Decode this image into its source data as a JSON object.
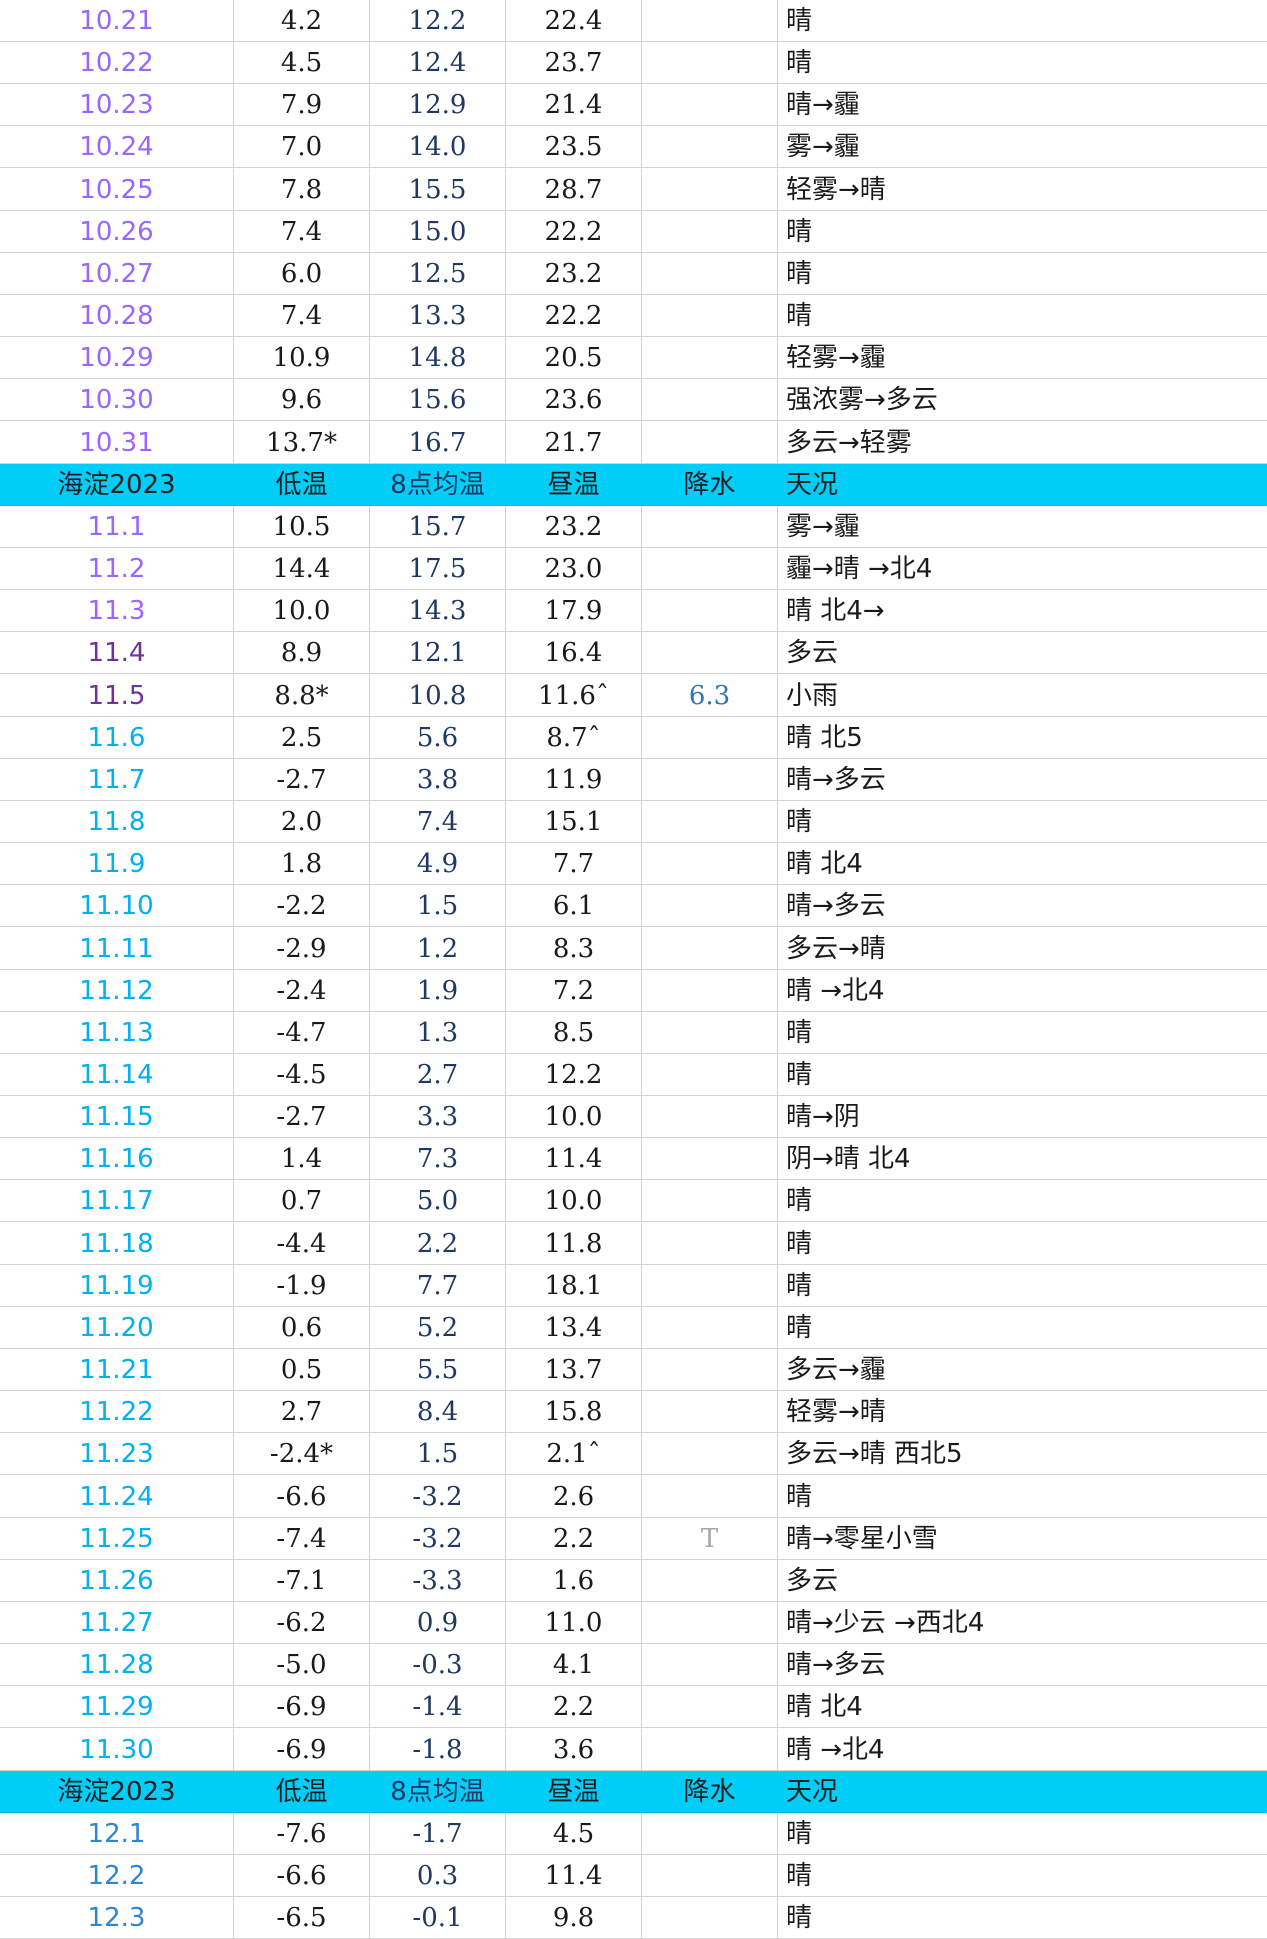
{
  "colors": {
    "header_bg": "#00cdf8",
    "date_purple": "#9966ff",
    "date_dark_purple": "#7030a0",
    "date_cyan": "#00b0f0",
    "date_blue": "#2e86d1",
    "rain_blue": "#2e75b6"
  },
  "rows": [
    {
      "type": "data",
      "date": "10.21",
      "low": "4.2",
      "avg": "12.2",
      "day": "22.4",
      "rain": "",
      "cond": "晴",
      "date_color": "#9966ff"
    },
    {
      "type": "data",
      "date": "10.22",
      "low": "4.5",
      "avg": "12.4",
      "day": "23.7",
      "rain": "",
      "cond": "晴",
      "date_color": "#9966ff"
    },
    {
      "type": "data",
      "date": "10.23",
      "low": "7.9",
      "avg": "12.9",
      "day": "21.4",
      "rain": "",
      "cond": "晴→霾",
      "date_color": "#9966ff"
    },
    {
      "type": "data",
      "date": "10.24",
      "low": "7.0",
      "avg": "14.0",
      "day": "23.5",
      "rain": "",
      "cond": "雾→霾",
      "date_color": "#9966ff"
    },
    {
      "type": "data",
      "date": "10.25",
      "low": "7.8",
      "avg": "15.5",
      "day": "28.7",
      "rain": "",
      "cond": "轻雾→晴",
      "date_color": "#9966ff"
    },
    {
      "type": "data",
      "date": "10.26",
      "low": "7.4",
      "avg": "15.0",
      "day": "22.2",
      "rain": "",
      "cond": "晴",
      "date_color": "#9966ff"
    },
    {
      "type": "data",
      "date": "10.27",
      "low": "6.0",
      "avg": "12.5",
      "day": "23.2",
      "rain": "",
      "cond": "晴",
      "date_color": "#9966ff"
    },
    {
      "type": "data",
      "date": "10.28",
      "low": "7.4",
      "avg": "13.3",
      "day": "22.2",
      "rain": "",
      "cond": "晴",
      "date_color": "#9966ff"
    },
    {
      "type": "data",
      "date": "10.29",
      "low": "10.9",
      "avg": "14.8",
      "day": "20.5",
      "rain": "",
      "cond": "轻雾→霾",
      "date_color": "#9966ff"
    },
    {
      "type": "data",
      "date": "10.30",
      "low": "9.6",
      "avg": "15.6",
      "day": "23.6",
      "rain": "",
      "cond": "强浓雾→多云",
      "date_color": "#9966ff"
    },
    {
      "type": "data",
      "date": "10.31",
      "low": "13.7*",
      "avg": "16.7",
      "day": "21.7",
      "rain": "",
      "cond": "多云→轻雾",
      "date_color": "#9966ff"
    },
    {
      "type": "header",
      "date": "海淀2023",
      "low": "低温",
      "avg": "8点均温",
      "day": "昼温",
      "rain": "降水",
      "cond": "天况"
    },
    {
      "type": "data",
      "date": "11.1",
      "low": "10.5",
      "avg": "15.7",
      "day": "23.2",
      "rain": "",
      "cond": "雾→霾",
      "date_color": "#9966ff"
    },
    {
      "type": "data",
      "date": "11.2",
      "low": "14.4",
      "avg": "17.5",
      "day": "23.0",
      "rain": "",
      "cond": "霾→晴 →北4",
      "date_color": "#9966ff"
    },
    {
      "type": "data",
      "date": "11.3",
      "low": "10.0",
      "avg": "14.3",
      "day": "17.9",
      "rain": "",
      "cond": "晴 北4→",
      "date_color": "#9966ff"
    },
    {
      "type": "data",
      "date": "11.4",
      "low": "8.9",
      "avg": "12.1",
      "day": "16.4",
      "rain": "",
      "cond": "多云",
      "date_color": "#7030a0"
    },
    {
      "type": "data",
      "date": "11.5",
      "low": "8.8*",
      "avg": "10.8",
      "day": "11.6ˆ",
      "rain": "6.3",
      "cond": "小雨",
      "date_color": "#7030a0"
    },
    {
      "type": "data",
      "date": "11.6",
      "low": "2.5",
      "avg": "5.6",
      "day": "8.7ˆ",
      "rain": "",
      "cond": "晴 北5",
      "date_color": "#00b0f0"
    },
    {
      "type": "data",
      "date": "11.7",
      "low": "-2.7",
      "avg": "3.8",
      "day": "11.9",
      "rain": "",
      "cond": "晴→多云",
      "date_color": "#00b0f0"
    },
    {
      "type": "data",
      "date": "11.8",
      "low": "2.0",
      "avg": "7.4",
      "day": "15.1",
      "rain": "",
      "cond": "晴",
      "date_color": "#00b0f0"
    },
    {
      "type": "data",
      "date": "11.9",
      "low": "1.8",
      "avg": "4.9",
      "day": "7.7",
      "rain": "",
      "cond": "晴 北4",
      "date_color": "#00b0f0"
    },
    {
      "type": "data",
      "date": "11.10",
      "low": "-2.2",
      "avg": "1.5",
      "day": "6.1",
      "rain": "",
      "cond": "晴→多云",
      "date_color": "#00b0f0"
    },
    {
      "type": "data",
      "date": "11.11",
      "low": "-2.9",
      "avg": "1.2",
      "day": "8.3",
      "rain": "",
      "cond": "多云→晴",
      "date_color": "#00b0f0"
    },
    {
      "type": "data",
      "date": "11.12",
      "low": "-2.4",
      "avg": "1.9",
      "day": "7.2",
      "rain": "",
      "cond": "晴 →北4",
      "date_color": "#00b0f0"
    },
    {
      "type": "data",
      "date": "11.13",
      "low": "-4.7",
      "avg": "1.3",
      "day": "8.5",
      "rain": "",
      "cond": "晴",
      "date_color": "#00b0f0"
    },
    {
      "type": "data",
      "date": "11.14",
      "low": "-4.5",
      "avg": "2.7",
      "day": "12.2",
      "rain": "",
      "cond": "晴",
      "date_color": "#00b0f0"
    },
    {
      "type": "data",
      "date": "11.15",
      "low": "-2.7",
      "avg": "3.3",
      "day": "10.0",
      "rain": "",
      "cond": "晴→阴",
      "date_color": "#00b0f0"
    },
    {
      "type": "data",
      "date": "11.16",
      "low": "1.4",
      "avg": "7.3",
      "day": "11.4",
      "rain": "",
      "cond": "阴→晴 北4",
      "date_color": "#00b0f0"
    },
    {
      "type": "data",
      "date": "11.17",
      "low": "0.7",
      "avg": "5.0",
      "day": "10.0",
      "rain": "",
      "cond": "晴",
      "date_color": "#00b0f0"
    },
    {
      "type": "data",
      "date": "11.18",
      "low": "-4.4",
      "avg": "2.2",
      "day": "11.8",
      "rain": "",
      "cond": "晴",
      "date_color": "#00b0f0"
    },
    {
      "type": "data",
      "date": "11.19",
      "low": "-1.9",
      "avg": "7.7",
      "day": "18.1",
      "rain": "",
      "cond": "晴",
      "date_color": "#00b0f0"
    },
    {
      "type": "data",
      "date": "11.20",
      "low": "0.6",
      "avg": "5.2",
      "day": "13.4",
      "rain": "",
      "cond": "晴",
      "date_color": "#00b0f0"
    },
    {
      "type": "data",
      "date": "11.21",
      "low": "0.5",
      "avg": "5.5",
      "day": "13.7",
      "rain": "",
      "cond": "多云→霾",
      "date_color": "#00b0f0"
    },
    {
      "type": "data",
      "date": "11.22",
      "low": "2.7",
      "avg": "8.4",
      "day": "15.8",
      "rain": "",
      "cond": "轻雾→晴",
      "date_color": "#00b0f0"
    },
    {
      "type": "data",
      "date": "11.23",
      "low": "-2.4*",
      "avg": "1.5",
      "day": "2.1ˆ",
      "rain": "",
      "cond": "多云→晴 西北5",
      "date_color": "#00b0f0"
    },
    {
      "type": "data",
      "date": "11.24",
      "low": "-6.6",
      "avg": "-3.2",
      "day": "2.6",
      "rain": "",
      "cond": "晴",
      "date_color": "#00b0f0"
    },
    {
      "type": "data",
      "date": "11.25",
      "low": "-7.4",
      "avg": "-3.2",
      "day": "2.2",
      "rain": "T",
      "cond": "晴→零星小雪",
      "date_color": "#00b0f0"
    },
    {
      "type": "data",
      "date": "11.26",
      "low": "-7.1",
      "avg": "-3.3",
      "day": "1.6",
      "rain": "",
      "cond": "多云",
      "date_color": "#00b0f0"
    },
    {
      "type": "data",
      "date": "11.27",
      "low": "-6.2",
      "avg": "0.9",
      "day": "11.0",
      "rain": "",
      "cond": "晴→少云 →西北4",
      "date_color": "#00b0f0"
    },
    {
      "type": "data",
      "date": "11.28",
      "low": "-5.0",
      "avg": "-0.3",
      "day": "4.1",
      "rain": "",
      "cond": "晴→多云",
      "date_color": "#00b0f0"
    },
    {
      "type": "data",
      "date": "11.29",
      "low": "-6.9",
      "avg": "-1.4",
      "day": "2.2",
      "rain": "",
      "cond": "晴 北4",
      "date_color": "#00b0f0"
    },
    {
      "type": "data",
      "date": "11.30",
      "low": "-6.9",
      "avg": "-1.8",
      "day": "3.6",
      "rain": "",
      "cond": "晴 →北4",
      "date_color": "#00b0f0"
    },
    {
      "type": "header",
      "date": "海淀2023",
      "low": "低温",
      "avg": "8点均温",
      "day": "昼温",
      "rain": "降水",
      "cond": "天况"
    },
    {
      "type": "data",
      "date": "12.1",
      "low": "-7.6",
      "avg": "-1.7",
      "day": "4.5",
      "rain": "",
      "cond": "晴",
      "date_color": "#2e86d1"
    },
    {
      "type": "data",
      "date": "12.2",
      "low": "-6.6",
      "avg": "0.3",
      "day": "11.4",
      "rain": "",
      "cond": "晴",
      "date_color": "#2e86d1"
    },
    {
      "type": "data",
      "date": "12.3",
      "low": "-6.5",
      "avg": "-0.1",
      "day": "9.8",
      "rain": "",
      "cond": "晴",
      "date_color": "#2e86d1"
    }
  ]
}
